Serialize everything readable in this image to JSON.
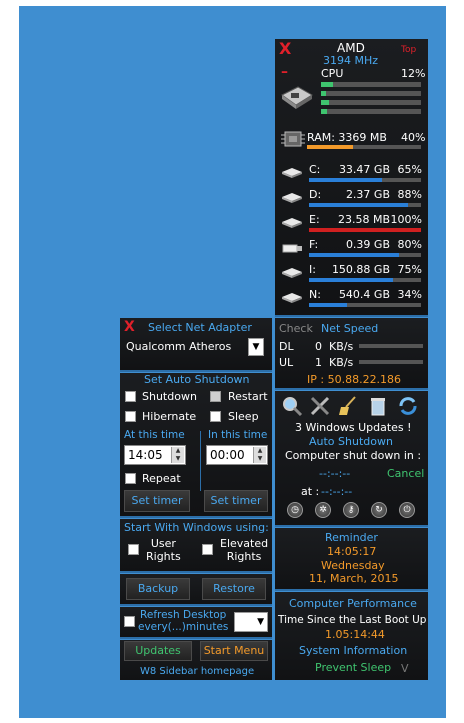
{
  "colors": {
    "desktop": "#3f8ed0",
    "accent": "#4aa9f0",
    "orange": "#f39a2a",
    "green": "#3fc46f",
    "red": "#e0202a"
  },
  "cpu": {
    "title": "AMD",
    "freq": "3194  MHz",
    "top": "Top",
    "label": "CPU",
    "percent": "12%",
    "core_usage": [
      0.12,
      0.05,
      0.08,
      0.06
    ]
  },
  "ram": {
    "label": "RAM: 3369 MB",
    "percent": "40%",
    "usage": 0.4
  },
  "drives": [
    {
      "letter": "C:",
      "size": "33.47 GB",
      "percent": "65%",
      "usage": 0.65,
      "color": "#2a7fd8"
    },
    {
      "letter": "D:",
      "size": "2.37 GB",
      "percent": "88%",
      "usage": 0.88,
      "color": "#2a7fd8"
    },
    {
      "letter": "E:",
      "size": "23.58 MB",
      "percent": "100%",
      "usage": 1.0,
      "color": "#d02020"
    },
    {
      "letter": "F:",
      "size": "0.39 GB",
      "percent": "80%",
      "usage": 0.8,
      "color": "#2a7fd8"
    },
    {
      "letter": "I:",
      "size": "150.88 GB",
      "percent": "75%",
      "usage": 0.75,
      "color": "#2a7fd8"
    },
    {
      "letter": "N:",
      "size": "540.4 GB",
      "percent": "34%",
      "usage": 0.34,
      "color": "#2a7fd8"
    }
  ],
  "net": {
    "check": "Check",
    "title": "Net  Speed",
    "dl_label": "DL",
    "dl_value": "0",
    "ul_label": "UL",
    "ul_value": "1",
    "unit": "KB/s",
    "ip": "IP : 50.88.22.186"
  },
  "tools": {
    "updates": "3 Windows Updates !",
    "auto_shutdown": "Auto Shutdown",
    "shutdown_in": "Computer shut down in :",
    "countdown": "--:--:--",
    "cancel": "Cancel",
    "at_label": "at :",
    "at_value": "--:--:--"
  },
  "reminder": {
    "title": "Reminder",
    "time": "14:05:17",
    "day": "Wednesday",
    "date": "11, March, 2015"
  },
  "perf": {
    "title": "Computer Performance",
    "uptime_label": "Time Since the Last Boot Up",
    "uptime": "1.05:14:44",
    "sysinfo": "System Information",
    "prevent": "Prevent Sleep",
    "prevent_suffix": "V"
  },
  "left": {
    "adapter_title": "Select Net Adapter",
    "adapter_value": "Qualcomm Atheros",
    "shutdown_title": "Set Auto Shutdown",
    "opt_shutdown": "Shutdown",
    "opt_restart": "Restart",
    "opt_hibernate": "Hibernate",
    "opt_sleep": "Sleep",
    "at_this_time": "At this time",
    "in_this_time": "In this time",
    "time_at": "14:05",
    "time_in": "00:00",
    "repeat": "Repeat",
    "set_timer": "Set timer",
    "startup_title": "Start With Windows using:",
    "user_rights": "User\nRights",
    "elevated_rights": "Elevated\nRights",
    "backup": "Backup",
    "restore": "Restore",
    "refresh": "Refresh Desktop\nevery(...)minutes",
    "updates": "Updates",
    "start_menu": "Start Menu",
    "homepage": "W8 Sidebar homepage"
  }
}
